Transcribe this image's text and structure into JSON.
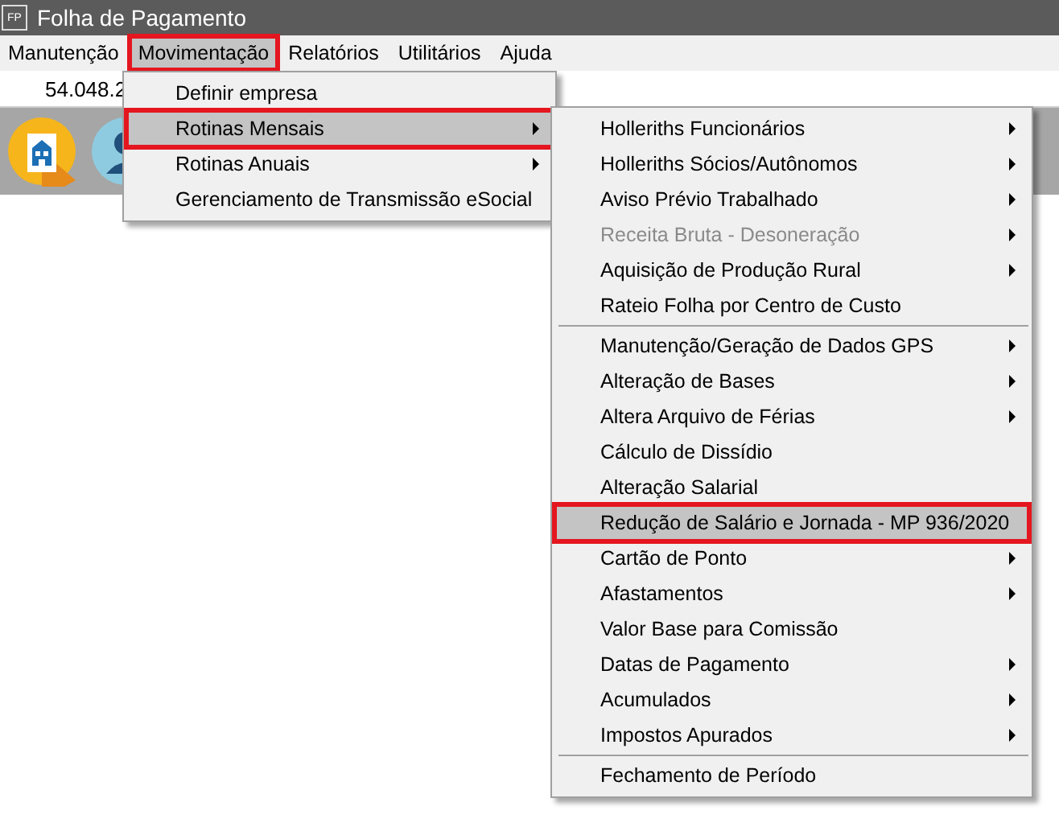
{
  "window": {
    "icon_text": "FP",
    "title": "Folha de Pagamento"
  },
  "menu_bar": [
    {
      "label": "Manutenção",
      "selected": false,
      "outlined": false
    },
    {
      "label": "Movimentação",
      "selected": true,
      "outlined": true
    },
    {
      "label": "Relatórios",
      "selected": false,
      "outlined": false
    },
    {
      "label": "Utilitários",
      "selected": false,
      "outlined": false
    },
    {
      "label": "Ajuda",
      "selected": false,
      "outlined": false
    }
  ],
  "company_field": {
    "value": "54.048.2"
  },
  "toolbar": [
    {
      "kind": "building"
    },
    {
      "kind": "person"
    }
  ],
  "dropdown": [
    {
      "label": "Definir empresa",
      "selected": false,
      "outlined": false,
      "has_submenu": false,
      "disabled": false
    },
    {
      "label": "Rotinas Mensais",
      "selected": true,
      "outlined": true,
      "has_submenu": true,
      "disabled": false
    },
    {
      "label": "Rotinas Anuais",
      "selected": false,
      "outlined": false,
      "has_submenu": true,
      "disabled": false
    },
    {
      "label": "Gerenciamento de Transmissão eSocial",
      "selected": false,
      "outlined": false,
      "has_submenu": false,
      "disabled": false
    }
  ],
  "submenu": [
    {
      "kind": "item",
      "label": "Holleriths Funcionários",
      "selected": false,
      "outlined": false,
      "has_submenu": true,
      "disabled": false
    },
    {
      "kind": "item",
      "label": "Holleriths Sócios/Autônomos",
      "selected": false,
      "outlined": false,
      "has_submenu": true,
      "disabled": false
    },
    {
      "kind": "item",
      "label": "Aviso Prévio Trabalhado",
      "selected": false,
      "outlined": false,
      "has_submenu": true,
      "disabled": false
    },
    {
      "kind": "item",
      "label": "Receita Bruta - Desoneração",
      "selected": false,
      "outlined": false,
      "has_submenu": true,
      "disabled": true
    },
    {
      "kind": "item",
      "label": "Aquisição de Produção Rural",
      "selected": false,
      "outlined": false,
      "has_submenu": true,
      "disabled": false
    },
    {
      "kind": "item",
      "label": "Rateio Folha por Centro de Custo",
      "selected": false,
      "outlined": false,
      "has_submenu": false,
      "disabled": false
    },
    {
      "kind": "separator"
    },
    {
      "kind": "item",
      "label": "Manutenção/Geração de Dados GPS",
      "selected": false,
      "outlined": false,
      "has_submenu": true,
      "disabled": false
    },
    {
      "kind": "item",
      "label": "Alteração de Bases",
      "selected": false,
      "outlined": false,
      "has_submenu": true,
      "disabled": false
    },
    {
      "kind": "item",
      "label": "Altera Arquivo de Férias",
      "selected": false,
      "outlined": false,
      "has_submenu": true,
      "disabled": false
    },
    {
      "kind": "item",
      "label": "Cálculo de Dissídio",
      "selected": false,
      "outlined": false,
      "has_submenu": false,
      "disabled": false
    },
    {
      "kind": "item",
      "label": "Alteração Salarial",
      "selected": false,
      "outlined": false,
      "has_submenu": false,
      "disabled": false
    },
    {
      "kind": "item",
      "label": "Redução de Salário e Jornada - MP 936/2020",
      "selected": true,
      "outlined": true,
      "has_submenu": false,
      "disabled": false
    },
    {
      "kind": "item",
      "label": "Cartão de Ponto",
      "selected": false,
      "outlined": false,
      "has_submenu": true,
      "disabled": false
    },
    {
      "kind": "item",
      "label": "Afastamentos",
      "selected": false,
      "outlined": false,
      "has_submenu": true,
      "disabled": false
    },
    {
      "kind": "item",
      "label": "Valor Base para Comissão",
      "selected": false,
      "outlined": false,
      "has_submenu": false,
      "disabled": false
    },
    {
      "kind": "item",
      "label": "Datas de Pagamento",
      "selected": false,
      "outlined": false,
      "has_submenu": true,
      "disabled": false
    },
    {
      "kind": "item",
      "label": "Acumulados",
      "selected": false,
      "outlined": false,
      "has_submenu": true,
      "disabled": false
    },
    {
      "kind": "item",
      "label": "Impostos Apurados",
      "selected": false,
      "outlined": false,
      "has_submenu": true,
      "disabled": false
    },
    {
      "kind": "separator"
    },
    {
      "kind": "item",
      "label": "Fechamento de Período",
      "selected": false,
      "outlined": false,
      "has_submenu": false,
      "disabled": false
    }
  ]
}
